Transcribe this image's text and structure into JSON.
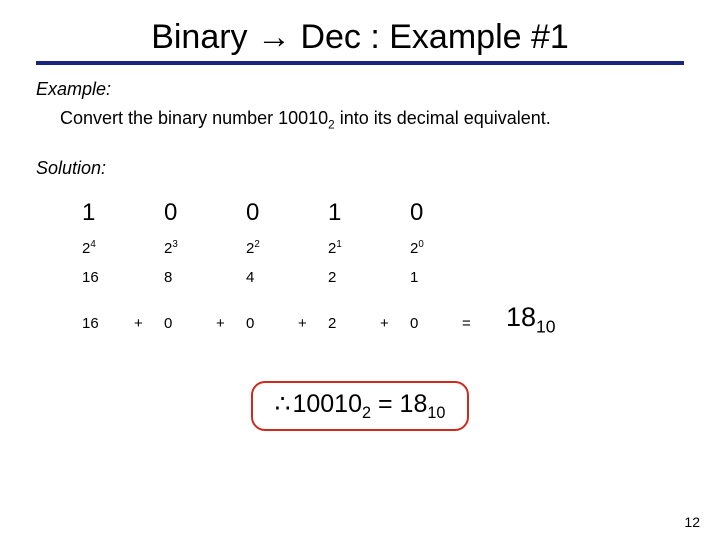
{
  "title": "Binary → Dec : Example #1",
  "example_label": "Example:",
  "prompt_pre": "Convert the binary number 10010",
  "prompt_sub": "2",
  "prompt_post": " into its decimal equivalent.",
  "solution_label": "Solution:",
  "table": {
    "bits": [
      "1",
      "0",
      "0",
      "1",
      "0"
    ],
    "pow_bases": [
      "2",
      "2",
      "2",
      "2",
      "2"
    ],
    "pow_exps": [
      "4",
      "3",
      "2",
      "1",
      "0"
    ],
    "dec_vals": [
      "16",
      "8",
      "4",
      "2",
      "1"
    ],
    "sum_vals": [
      "16",
      "0",
      "0",
      "2",
      "0"
    ],
    "ops": [
      "+",
      "+",
      "+",
      "+"
    ],
    "eq": "="
  },
  "result_val": "18",
  "result_sub": "10",
  "conclusion": {
    "therefore": "∴",
    "bin_val": "10010",
    "bin_sub": "2",
    "eq": " = ",
    "dec_val": "18",
    "dec_sub": "10"
  },
  "page_number": "12"
}
